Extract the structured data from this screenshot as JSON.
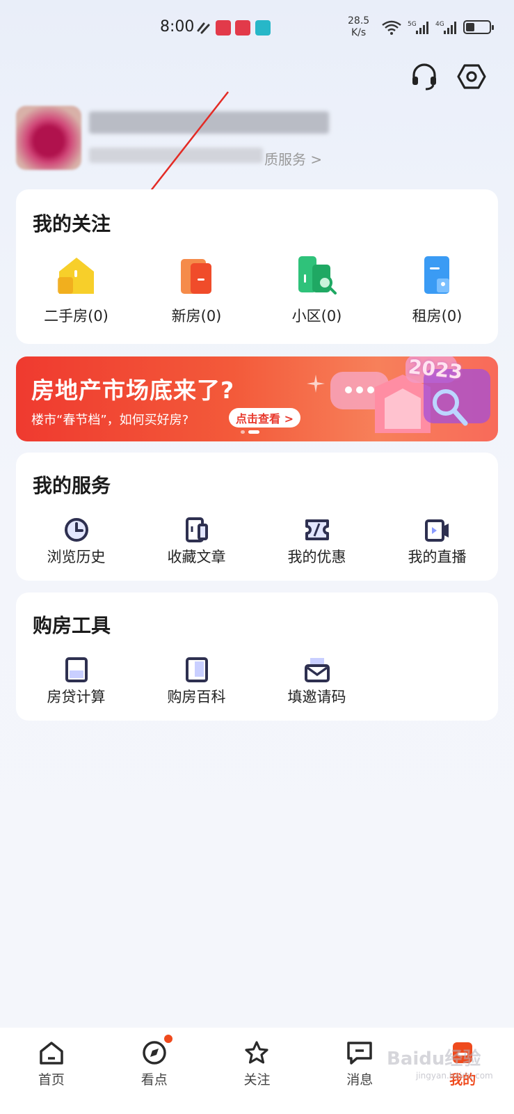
{
  "status_bar": {
    "time": "8:00",
    "speed_value": "28.5",
    "speed_unit": "K/s"
  },
  "header": {
    "support_icon": "headset-icon",
    "settings_icon": "hexagon-gear-icon"
  },
  "profile": {
    "subtitle": "质服务 >"
  },
  "follow": {
    "title": "我的关注",
    "items": [
      {
        "label": "二手房(0)",
        "icon": "second-hand-house-icon",
        "color": "#f5c518"
      },
      {
        "label": "新房(0)",
        "icon": "new-house-icon",
        "color": "#f25a2a"
      },
      {
        "label": "小区(0)",
        "icon": "community-search-icon",
        "color": "#25b46a"
      },
      {
        "label": "租房(0)",
        "icon": "rental-icon",
        "color": "#2f8ff2"
      }
    ]
  },
  "banner": {
    "title": "房地产市场底来了?",
    "subtitle": "楼市“春节档”，如何买好房?",
    "cta": "点击查看 >",
    "badge": "2023"
  },
  "services": {
    "title": "我的服务",
    "items": [
      {
        "label": "浏览历史",
        "icon": "clock-icon"
      },
      {
        "label": "收藏文章",
        "icon": "bookmark-article-icon"
      },
      {
        "label": "我的优惠",
        "icon": "coupon-icon"
      },
      {
        "label": "我的直播",
        "icon": "live-video-icon"
      }
    ]
  },
  "tools": {
    "title": "购房工具",
    "items": [
      {
        "label": "房贷计算",
        "icon": "calculator-icon"
      },
      {
        "label": "购房百科",
        "icon": "encyclopedia-icon"
      },
      {
        "label": "填邀请码",
        "icon": "invite-envelope-icon"
      }
    ]
  },
  "tabbar": {
    "items": [
      {
        "label": "首页",
        "icon": "home-icon"
      },
      {
        "label": "看点",
        "icon": "compass-icon"
      },
      {
        "label": "关注",
        "icon": "star-icon"
      },
      {
        "label": "消息",
        "icon": "message-icon"
      },
      {
        "label": "我的",
        "icon": "profile-icon"
      }
    ],
    "active_color": "#ef4a1d"
  },
  "watermark": {
    "text": "Baidu经验",
    "sub": "jingyan.baidu.com"
  }
}
